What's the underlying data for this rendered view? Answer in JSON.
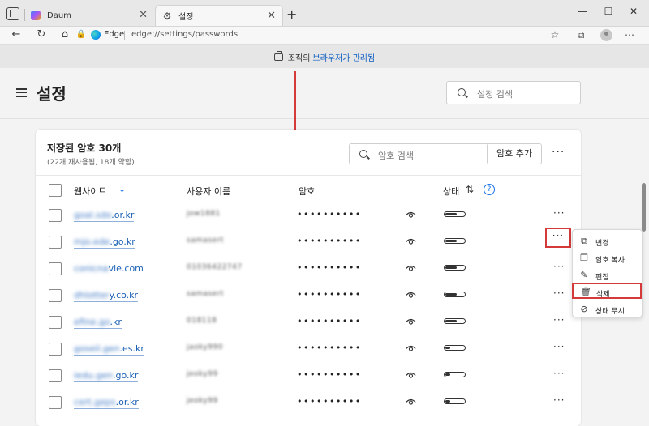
{
  "tabs": [
    {
      "label": "Daum"
    },
    {
      "label": "설정"
    }
  ],
  "address_bar": {
    "edge_label": "Edge",
    "url": "edge://settings/passwords"
  },
  "banner": {
    "prefix": "조직의",
    "link": "브라우저가 관리됨"
  },
  "settings": {
    "title": "설정",
    "search_placeholder": "설정 검색"
  },
  "passwords": {
    "title": "저장된 암호 30개",
    "subtitle": "(22개 재사용됨, 18개 약함)",
    "search_placeholder": "암호 검색",
    "add_label": "암호 추가",
    "columns": {
      "site": "웹사이트",
      "user": "사용자 이름",
      "password": "암호",
      "status": "상태"
    },
    "rows": [
      {
        "site_hidden": "goal.sdo",
        "site_visible": ".or.kr",
        "user": "jow1881",
        "password": "••••••••••",
        "status": "strong"
      },
      {
        "site_hidden": "mjo.ede",
        "site_visible": ".go.kr",
        "user": "samasert",
        "password": "••••••••••",
        "status": "strong"
      },
      {
        "site_hidden": "conicna",
        "site_visible": "vie.com",
        "user": "01036422747",
        "password": "••••••••••",
        "status": "strong"
      },
      {
        "site_hidden": "dhlotter",
        "site_visible": "y.co.kr",
        "user": "samasert",
        "password": "••••••••••",
        "status": "strong"
      },
      {
        "site_hidden": "efine.go",
        "site_visible": ".kr",
        "user": "018118",
        "password": "••••••••••",
        "status": "strong"
      },
      {
        "site_hidden": "goseil.gen",
        "site_visible": ".es.kr",
        "user": "jaoky990",
        "password": "••••••••••",
        "status": "weak"
      },
      {
        "site_hidden": "iedu.gen",
        "site_visible": ".go.kr",
        "user": "jeoky99",
        "password": "••••••••••",
        "status": "weak"
      },
      {
        "site_hidden": "cert.geps",
        "site_visible": ".or.kr",
        "user": "jeoky99",
        "password": "••••••••••",
        "status": "weak"
      }
    ]
  },
  "context_menu": {
    "items": [
      {
        "label": "변경",
        "icon": "external-link-icon",
        "glyph": "⧉"
      },
      {
        "label": "암호 복사",
        "icon": "copy-icon",
        "glyph": "❐"
      },
      {
        "label": "편집",
        "icon": "pencil-icon",
        "glyph": "✎"
      },
      {
        "label": "삭제",
        "icon": "trash-icon",
        "glyph": "🗑"
      },
      {
        "label": "상태 무시",
        "icon": "ignore-icon",
        "glyph": "⊘"
      }
    ]
  },
  "colors": {
    "highlight": "#d53a3a",
    "link": "#1a5fb4",
    "accent": "#1a73e8"
  }
}
